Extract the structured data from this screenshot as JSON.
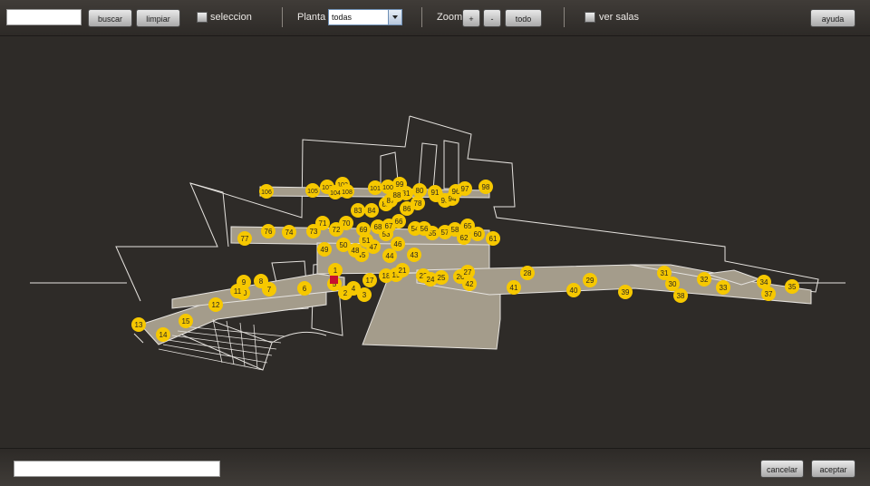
{
  "toolbar": {
    "search": {
      "value": "",
      "placeholder": ""
    },
    "search_button": "buscar",
    "clear_button": "limpiar",
    "selection_label": "seleccion",
    "floor_label": "Planta",
    "floor_value": "todas",
    "zoom_label": "Zoom",
    "zoom_in": "+",
    "zoom_out": "-",
    "zoom_all": "todo",
    "rooms_label": "ver salas",
    "help_button": "ayuda"
  },
  "map": {
    "marker_color": "#f6c800",
    "selected_color": "#c8102e",
    "markers": [
      "1",
      "2",
      "3",
      "4",
      "5",
      "6",
      "7",
      "8",
      "9",
      "10",
      "11",
      "12",
      "13",
      "14",
      "15",
      "17",
      "18",
      "19",
      "21",
      "23",
      "24",
      "25",
      "26",
      "27",
      "28",
      "29",
      "30",
      "31",
      "32",
      "33",
      "34",
      "35",
      "37",
      "38",
      "39",
      "40",
      "41",
      "42",
      "43",
      "44",
      "45",
      "46",
      "47",
      "48",
      "49",
      "50",
      "51",
      "53",
      "54",
      "55",
      "56",
      "57",
      "58",
      "60",
      "61",
      "62",
      "65",
      "66",
      "67",
      "68",
      "69",
      "70",
      "71",
      "72",
      "73",
      "74",
      "76",
      "77",
      "78",
      "80",
      "81",
      "82",
      "83",
      "84",
      "86",
      "87",
      "88",
      "90",
      "91",
      "93",
      "94",
      "96",
      "97",
      "98",
      "99",
      "100",
      "101",
      "102",
      "103",
      "104",
      "105",
      "106",
      "108"
    ]
  },
  "footer": {
    "name_field": {
      "value": ""
    },
    "cancel_button": "cancelar",
    "accept_button": "aceptar"
  }
}
